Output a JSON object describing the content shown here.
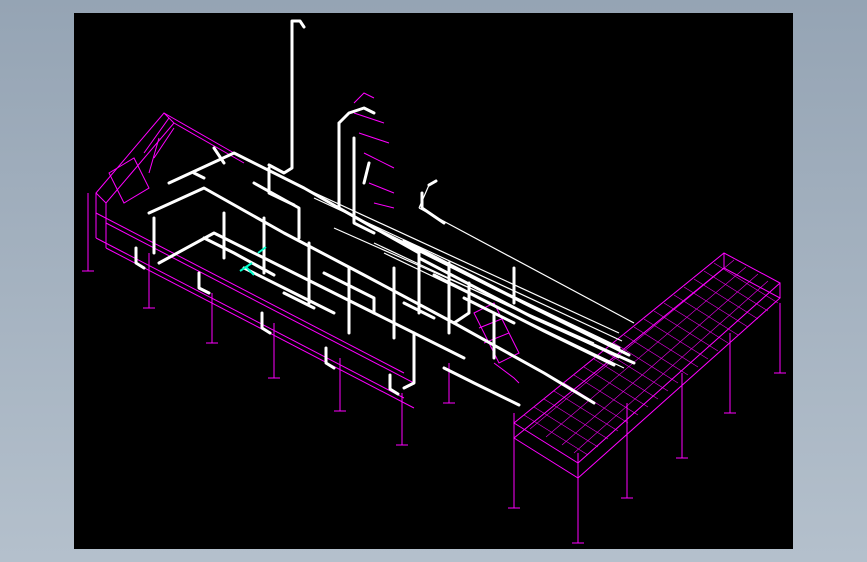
{
  "colors": {
    "backdrop": "#a3b0be",
    "canvas": "#000000",
    "pipe": "#ffffff",
    "structure": "#ff00ff",
    "marker": "#00ffcc"
  },
  "model": {
    "view": "isometric",
    "content": "piping-and-steel-structure-model"
  }
}
